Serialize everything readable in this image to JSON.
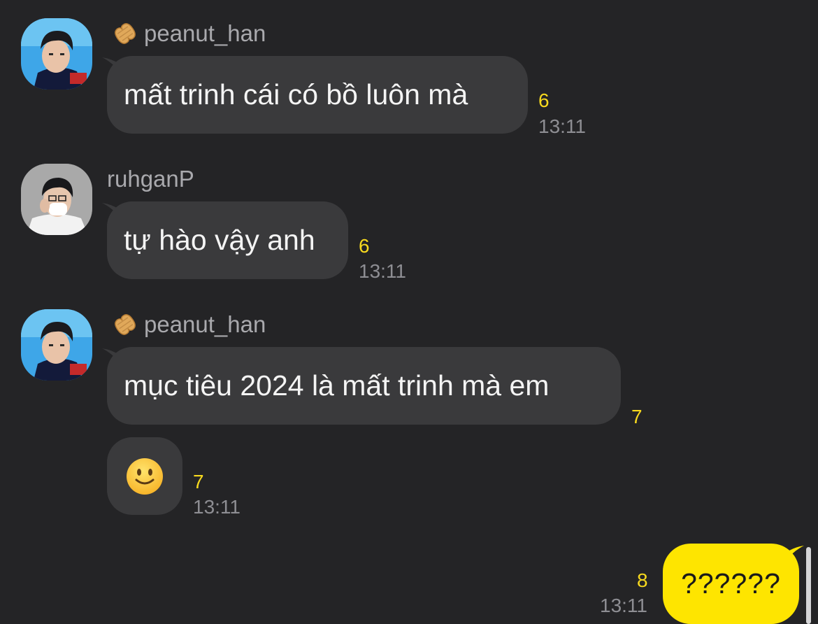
{
  "colors": {
    "background": "#242426",
    "bubble_other": "#3a3a3c",
    "bubble_mine": "#fee500",
    "unread": "#f7d91e",
    "timestamp": "#8e8e93"
  },
  "messages": [
    {
      "sender": "peanut_han",
      "sender_icon": "peanut-icon",
      "text": "mất trinh cái có bồ luôn mà",
      "unread": "6",
      "time": "13:11"
    },
    {
      "sender": "ruhganP",
      "text": "tự hào vậy anh",
      "unread": "6",
      "time": "13:11"
    },
    {
      "sender": "peanut_han",
      "sender_icon": "peanut-icon",
      "text": "mục tiêu 2024 là mất trinh mà em",
      "unread": "7"
    },
    {
      "emoji": "slightly-smiling-face",
      "unread": "7",
      "time": "13:11"
    }
  ],
  "my_message": {
    "text": "??????",
    "unread": "8",
    "time": "13:11"
  }
}
